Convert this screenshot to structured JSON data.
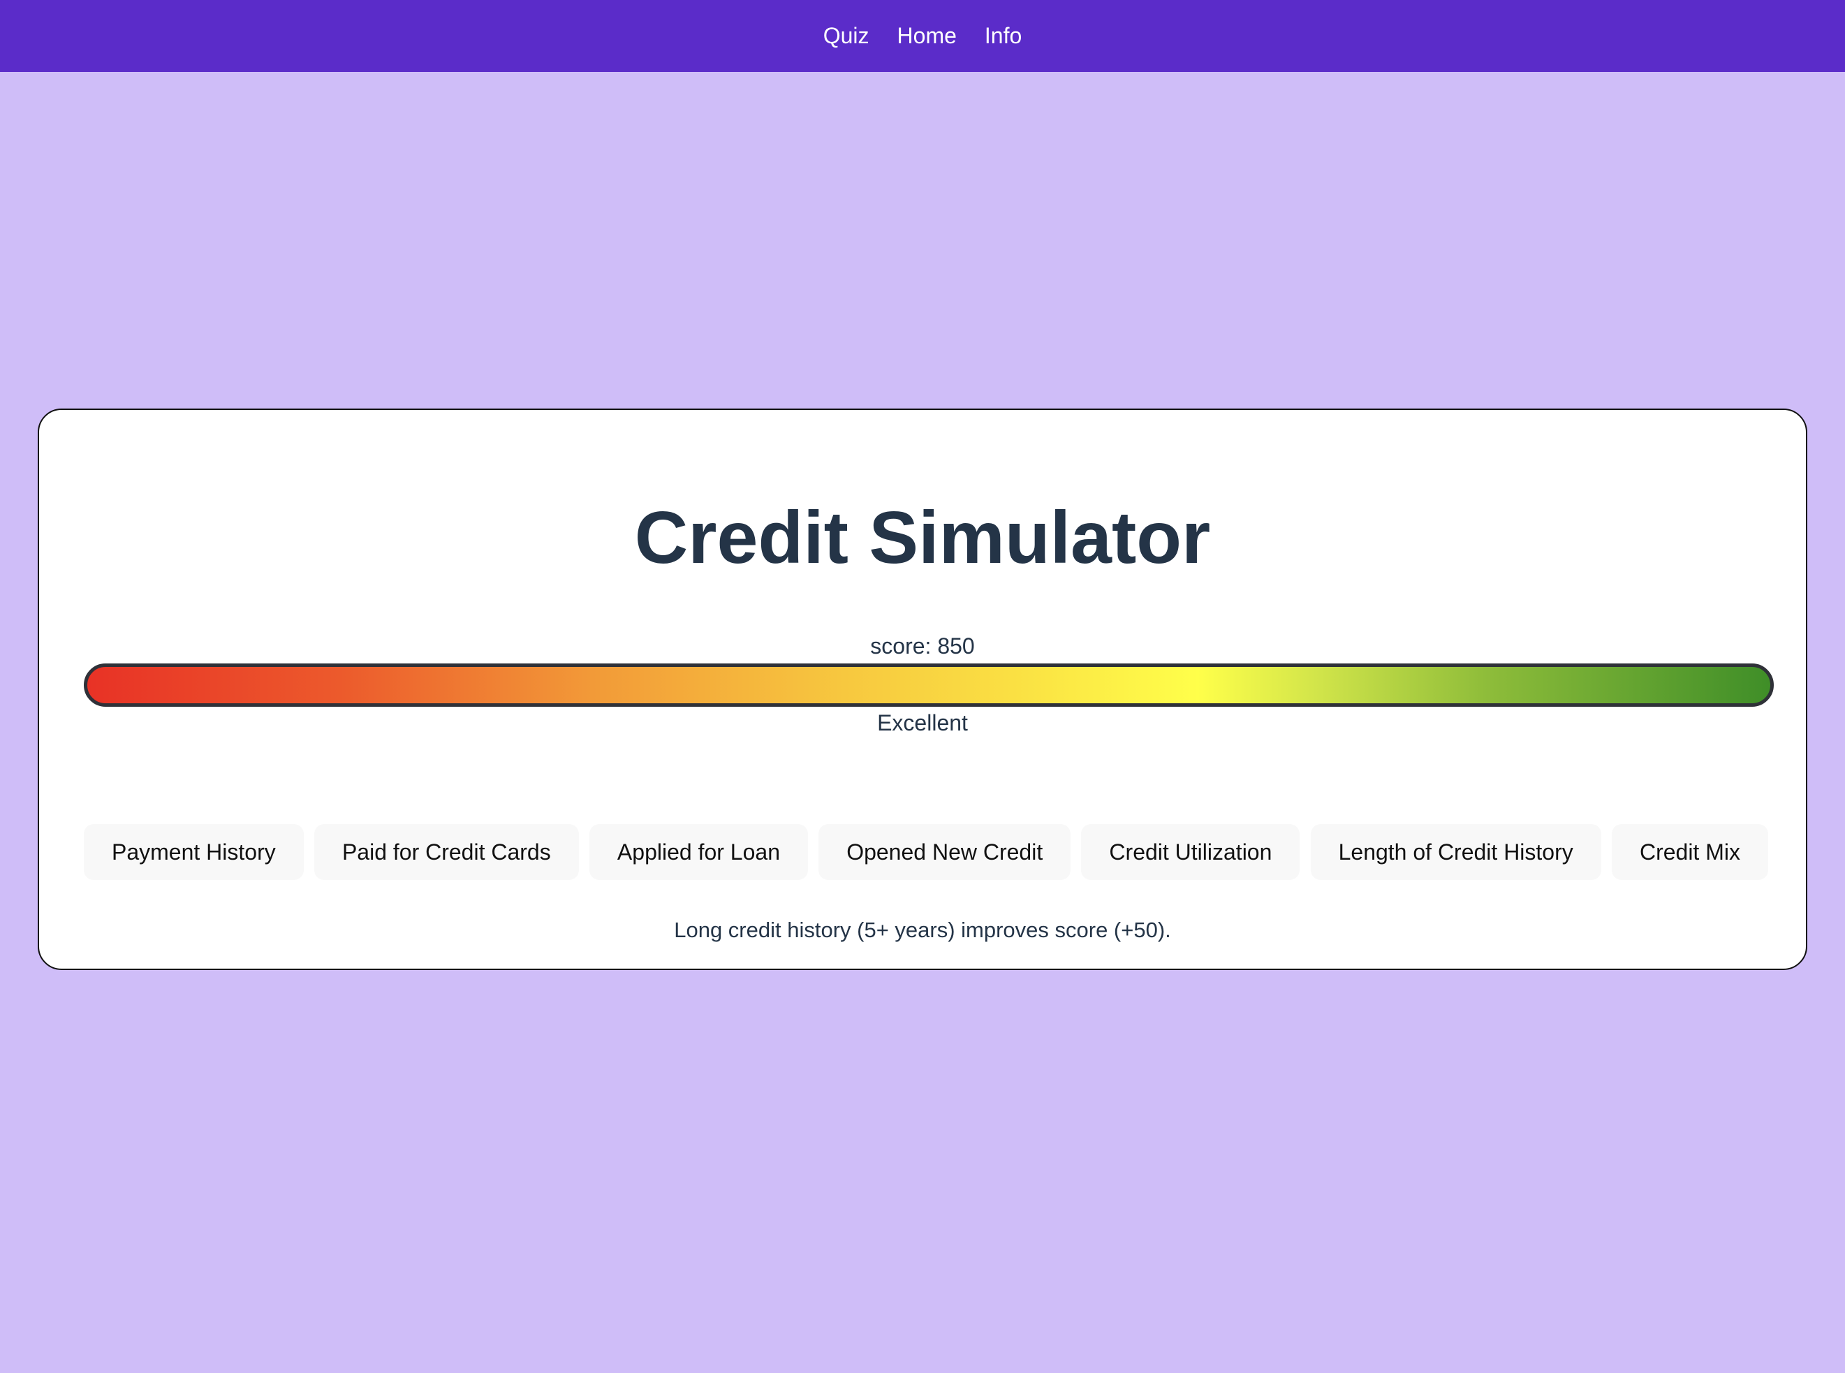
{
  "nav": {
    "links": [
      "Quiz",
      "Home",
      "Info"
    ]
  },
  "simulator": {
    "title": "Credit Simulator",
    "score_text": "score: 850",
    "score_value": 850,
    "rating": "Excellent",
    "tabs": [
      "Payment History",
      "Paid for Credit Cards",
      "Applied for Loan",
      "Opened New Credit",
      "Credit Utilization",
      "Length of Credit History",
      "Credit Mix"
    ],
    "description": "Long credit history (5+ years) improves score (+50)."
  },
  "colors": {
    "nav_background": "#5b2cc9",
    "page_background": "#cfbdf8",
    "title_text": "#243447",
    "gradient_start": "#e83226",
    "gradient_mid": "#ffff4a",
    "gradient_end": "#3f8e28"
  }
}
